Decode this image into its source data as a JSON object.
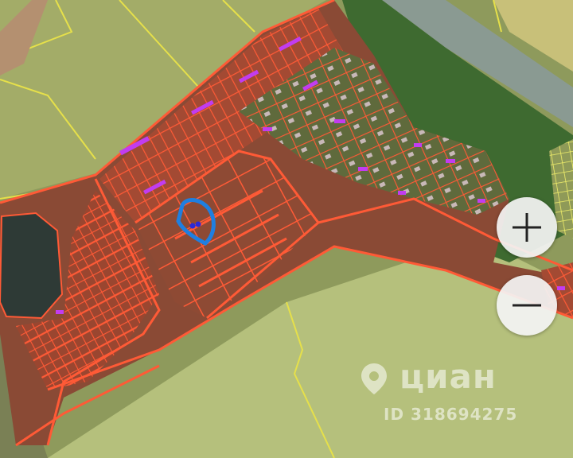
{
  "map": {
    "type": "satellite-cadastral",
    "colors": {
      "parcel_outline": "#ff5a36",
      "settlement_area": "#8a4a35",
      "field_boundary": "#e6e04a",
      "building": "#c23cf0",
      "selection_outline": "#1f7fe0",
      "marker": "#2a2ad8"
    }
  },
  "controls": {
    "zoom_in_icon": "plus-icon",
    "zoom_out_icon": "minus-icon"
  },
  "watermark": {
    "brand": "циан",
    "listing_id": "ID 318694275",
    "icon": "map-pin-icon"
  }
}
